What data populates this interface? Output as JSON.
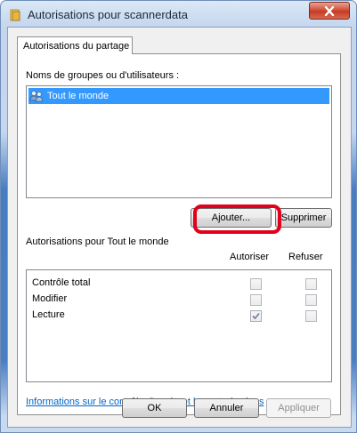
{
  "window": {
    "title": "Autorisations pour scannerdata"
  },
  "tabs": [
    {
      "label": "Autorisations du partage"
    }
  ],
  "groups_label": "Noms de groupes ou d'utilisateurs :",
  "users": [
    {
      "name": "Tout le monde",
      "selected": true
    }
  ],
  "buttons": {
    "add": "Ajouter...",
    "remove": "Supprimer"
  },
  "permissions": {
    "label": "Autorisations pour Tout le monde",
    "col_allow": "Autoriser",
    "col_deny": "Refuser",
    "rows": [
      {
        "name": "Contrôle total",
        "allow": false,
        "deny": false
      },
      {
        "name": "Modifier",
        "allow": false,
        "deny": false
      },
      {
        "name": "Lecture",
        "allow": true,
        "deny": false
      }
    ]
  },
  "info_link": "Informations sur le contrôle d'accès et les autorisations",
  "footer": {
    "ok": "OK",
    "cancel": "Annuler",
    "apply": "Appliquer"
  },
  "colors": {
    "selection": "#3399ff",
    "highlight": "#e2001a",
    "link": "#0066cc"
  }
}
